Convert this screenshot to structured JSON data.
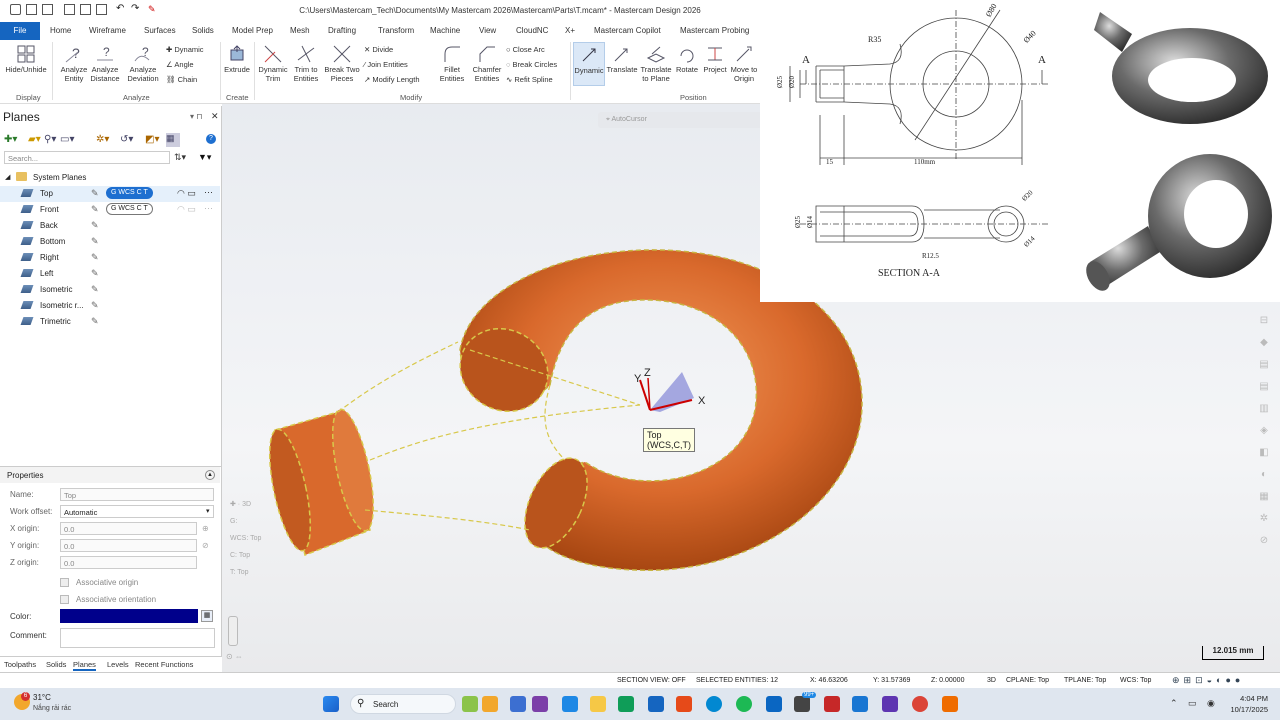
{
  "window": {
    "title": "C:\\Users\\Mastercam_Tech\\Documents\\My Mastercam 2026\\Mastercam\\Parts\\T.mcam* - Mastercam Design 2026"
  },
  "menu_tabs": [
    "File",
    "Home",
    "Wireframe",
    "Surfaces",
    "Solids",
    "Model Prep",
    "Mesh",
    "Drafting",
    "Transform",
    "Machine",
    "View",
    "CloudNC",
    "X+",
    "Mastercam Copilot",
    "Mastercam Probing"
  ],
  "ribbon": {
    "display": {
      "hide_unhide": "Hide/Unhide",
      "label": "Display"
    },
    "analyze": {
      "entity": "Analyze Entity",
      "distance": "Analyze Distance",
      "deviation": "Analyze Deviation",
      "dynamic": "Dynamic",
      "angle": "Angle",
      "chain": "Chain",
      "label": "Analyze"
    },
    "create": {
      "extrude": "Extrude",
      "label": "Create"
    },
    "modify": {
      "dynamic_trim": "Dynamic Trim",
      "trim_to_entities": "Trim to Entities",
      "break_two_pieces": "Break Two Pieces",
      "divide": "Divide",
      "join_entities": "Join Entities",
      "modify_length": "Modify Length",
      "fillet_entities": "Fillet Entities",
      "chamfer_entities": "Chamfer Entities",
      "close_arc": "Close Arc",
      "break_circles": "Break Circles",
      "refit_spline": "Refit Spline",
      "label": "Modify"
    },
    "position": {
      "dynamic": "Dynamic",
      "translate": "Translate",
      "translate_to_plane": "Translate to Plane",
      "rotate": "Rotate",
      "project": "Project",
      "move_to_origin": "Move to Origin",
      "label": "Position"
    }
  },
  "planes_panel": {
    "title": "Planes",
    "search_placeholder": "Search...",
    "group": "System Planes",
    "items": [
      {
        "name": "Top",
        "pill": "G  WCS  C  T",
        "active": true
      },
      {
        "name": "Front",
        "pill": "G  WCS  C  T",
        "active": false
      },
      {
        "name": "Back"
      },
      {
        "name": "Bottom"
      },
      {
        "name": "Right"
      },
      {
        "name": "Left"
      },
      {
        "name": "Isometric"
      },
      {
        "name": "Isometric r..."
      },
      {
        "name": "Trimetric"
      }
    ]
  },
  "properties": {
    "title": "Properties",
    "name_label": "Name:",
    "name_value": "Top",
    "work_offset_label": "Work offset:",
    "work_offset_value": "Automatic",
    "x_label": "X origin:",
    "x_value": "0.0",
    "y_label": "Y origin:",
    "y_value": "0.0",
    "z_label": "Z origin:",
    "z_value": "0.0",
    "assoc_origin": "Associative origin",
    "assoc_orient": "Associative orientation",
    "color_label": "Color:",
    "color_value": "#00008b",
    "comment_label": "Comment:"
  },
  "bottom_tabs": [
    "Toolpaths",
    "Solids",
    "Planes",
    "Levels",
    "Recent Functions"
  ],
  "viewport": {
    "autocursor": "AutoCursor",
    "gnomon_tooltip_line1": "Top",
    "gnomon_tooltip_line2": "(WCS,C,T)",
    "axis_x": "X",
    "axis_y": "Y",
    "axis_z": "Z",
    "mini_3d": "3D",
    "mini_g": "G:",
    "mini_wcs": "WCS:  Top",
    "mini_c": "C:  Top",
    "mini_t": "T:  Top",
    "scale": "12.015 mm",
    "part_color": "#d9692c"
  },
  "reference": {
    "r35": "R35",
    "d80": "Ø80",
    "d40": "Ø40",
    "d25": "Ø25",
    "d20": "Ø20",
    "d14": "Ø14",
    "dim15": "15",
    "dim110": "110mm",
    "r12_5": "R12.5",
    "label_a": "A",
    "section": "SECTION A-A"
  },
  "statusbar": {
    "section_view": "SECTION VIEW: OFF",
    "selected": "SELECTED ENTITIES: 12",
    "x": "X:    46.63206",
    "y": "Y:    31.57369",
    "z": "Z:    0.00000",
    "mode": "3D",
    "cplane": "CPLANE: Top",
    "tplane": "TPLANE: Top",
    "wcs": "WCS: Top"
  },
  "taskbar": {
    "weather_temp": "31°C",
    "weather_desc": "Nắng rải rác",
    "search": "Search",
    "time": "4:04 PM",
    "date": "10/17/2025",
    "badge_weather": "6",
    "badge_app": "99+"
  }
}
